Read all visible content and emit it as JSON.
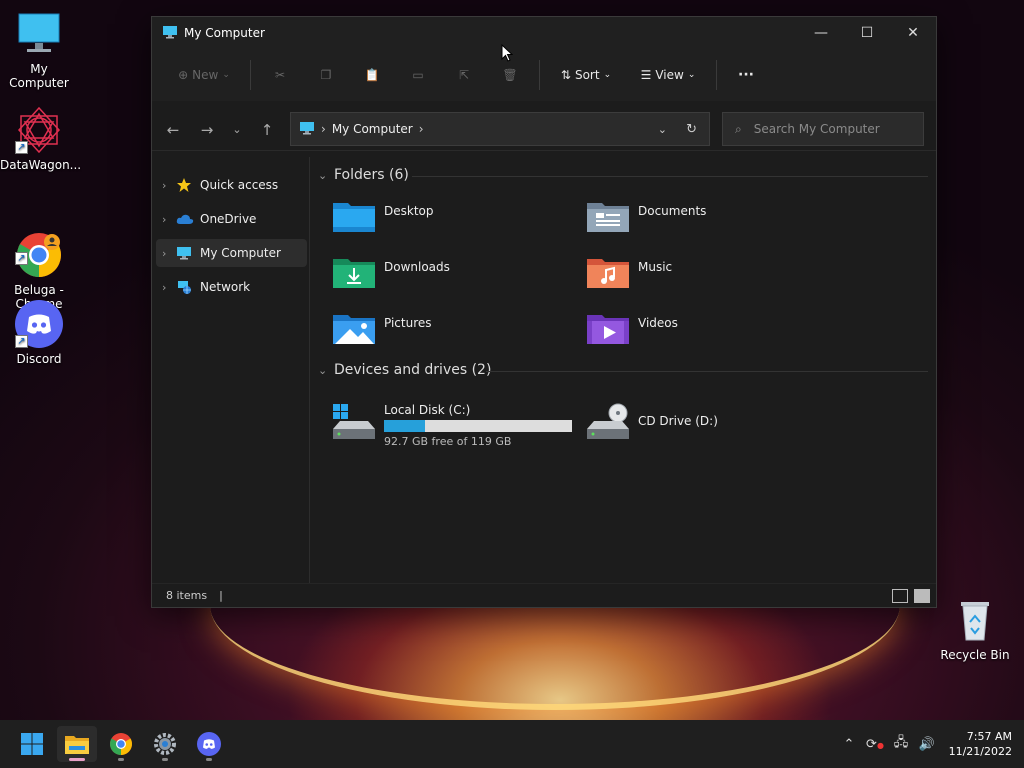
{
  "desktop": {
    "icons": [
      {
        "label": "My Computer"
      },
      {
        "label": "DataWagon..."
      },
      {
        "label": "Beluga -\nChrome"
      },
      {
        "label": "Discord"
      }
    ],
    "recycle_bin": "Recycle Bin"
  },
  "window": {
    "title": "My Computer",
    "controls": {
      "minimize": "—",
      "maximize": "☐",
      "close": "✕"
    }
  },
  "toolbar": {
    "new_label": "New",
    "sort_label": "Sort",
    "view_label": "View",
    "more_label": "···"
  },
  "address": {
    "location": "My Computer",
    "search_placeholder": "Search My Computer"
  },
  "nav": {
    "items": [
      {
        "label": "Quick access"
      },
      {
        "label": "OneDrive"
      },
      {
        "label": "My Computer"
      },
      {
        "label": "Network"
      }
    ]
  },
  "folders": {
    "header": "Folders (6)",
    "items": [
      {
        "name": "Desktop",
        "color": "#1e9be8"
      },
      {
        "name": "Documents",
        "color": "#8fa3b8"
      },
      {
        "name": "Downloads",
        "color": "#1fa870"
      },
      {
        "name": "Music",
        "color": "#e8704a"
      },
      {
        "name": "Pictures",
        "color": "#2a8fe0"
      },
      {
        "name": "Videos",
        "color": "#8a4bd8"
      }
    ]
  },
  "drives": {
    "header": "Devices and drives (2)",
    "items": [
      {
        "name": "Local Disk (C:)",
        "free_text": "92.7 GB free of 119 GB",
        "used_fraction": 0.22
      },
      {
        "name": "CD Drive (D:)"
      }
    ]
  },
  "status": {
    "items_text": "8 items"
  },
  "taskbar": {
    "time": "7:57 AM",
    "date": "11/21/2022"
  },
  "colors": {
    "accent": "#1e90e0",
    "window_bg": "#1c1c1c"
  }
}
